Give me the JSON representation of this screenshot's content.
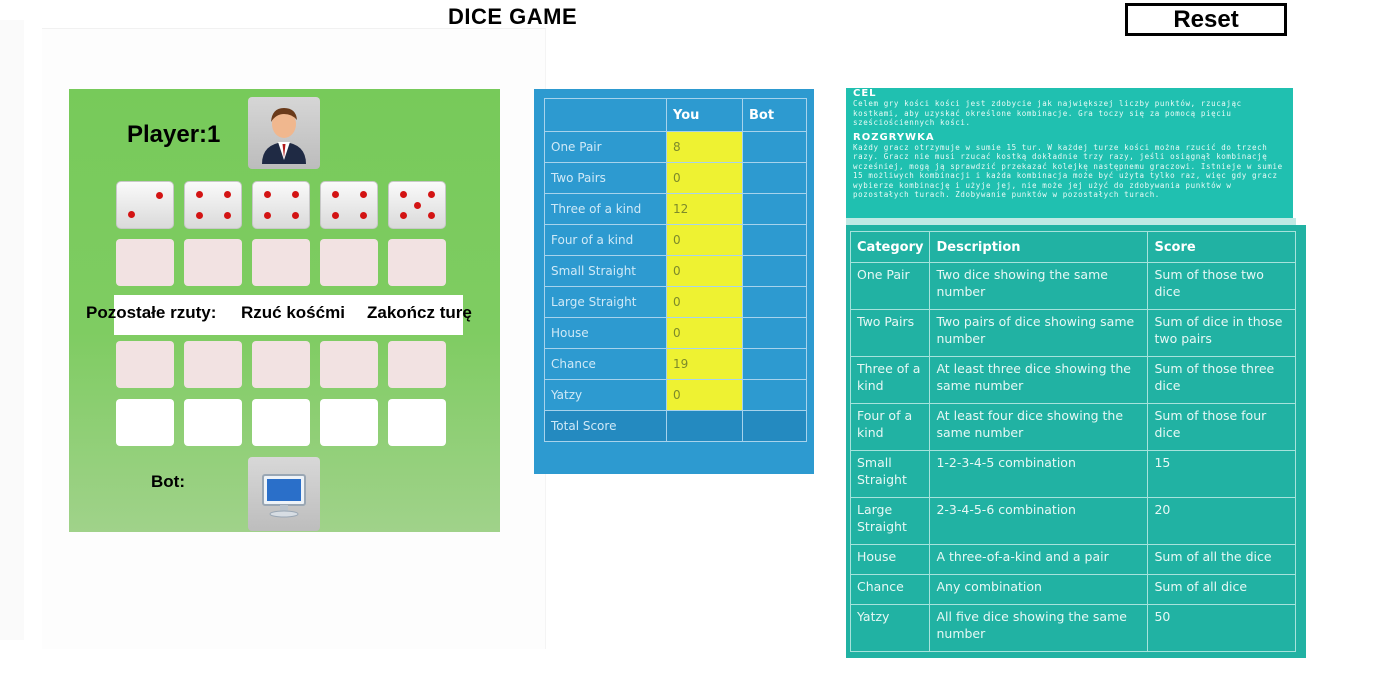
{
  "header": {
    "title": "DICE GAME",
    "reset_label": "Reset"
  },
  "board": {
    "player_label": "Player:1",
    "bot_label": "Bot:",
    "controls": {
      "remaining_label": "Pozostałe rzuty:",
      "roll_label": "Rzuć kośćmi",
      "end_turn_label": "Zakończ turę"
    },
    "dice_values": [
      2,
      4,
      4,
      4,
      5
    ],
    "colors": {
      "board": "#7fcc62",
      "pip": "#d31414"
    }
  },
  "score_table": {
    "headers": [
      "",
      "You",
      "Bot"
    ],
    "rows": [
      {
        "category": "One Pair",
        "you": "8",
        "bot": ""
      },
      {
        "category": "Two Pairs",
        "you": "0",
        "bot": ""
      },
      {
        "category": "Three of a kind",
        "you": "12",
        "bot": ""
      },
      {
        "category": "Four of a kind",
        "you": "0",
        "bot": ""
      },
      {
        "category": "Small Straight",
        "you": "0",
        "bot": ""
      },
      {
        "category": "Large Straight",
        "you": "0",
        "bot": ""
      },
      {
        "category": "House",
        "you": "0",
        "bot": ""
      },
      {
        "category": "Chance",
        "you": "19",
        "bot": ""
      },
      {
        "category": "Yatzy",
        "you": "0",
        "bot": ""
      }
    ],
    "total_label": "Total Score",
    "colors": {
      "background": "#2d9ad0",
      "highlight": "#eef232"
    }
  },
  "rules": {
    "goal_heading": "CEL",
    "goal_text": "Celem gry kości kości jest zdobycie jak największej liczby punktów, rzucając kostkami, aby uzyskać określone kombinacje. Gra toczy się za pomocą pięciu sześciościennych kości.",
    "play_heading": "ROZGRYWKA",
    "play_text": "Każdy gracz otrzymuje w sumie 15 tur. W każdej turze kości można rzucić do trzech razy. Gracz nie musi rzucać kostką dokładnie trzy razy, jeśli osiągnął kombinację wcześniej, mogą ją sprawdzić przekazać kolejkę następnemu graczowi. Istnieje w sumie 15 możliwych kombinacji i każda kombinacja może być użyta tylko raz, więc gdy gracz wybierze kombinację i użyje jej, nie może jej użyć do zdobywania punktów w pozostałych turach. Zdobywanie punktów w pozostałych turach."
  },
  "categories_table": {
    "headers": [
      "Category",
      "Description",
      "Score"
    ],
    "rows": [
      [
        "One Pair",
        "Two dice showing the same number",
        "Sum of those two dice"
      ],
      [
        "Two Pairs",
        "Two pairs of dice showing same number",
        "Sum of dice in those two pairs"
      ],
      [
        "Three of a kind",
        "At least three dice showing the same number",
        "Sum of those three dice"
      ],
      [
        "Four of a kind",
        "At least four dice showing the same number",
        "Sum of those four dice"
      ],
      [
        "Small Straight",
        "1-2-3-4-5 combination",
        "15"
      ],
      [
        "Large Straight",
        "2-3-4-5-6 combination",
        "20"
      ],
      [
        "House",
        "A three-of-a-kind and a pair",
        "Sum of all the dice"
      ],
      [
        "Chance",
        "Any combination",
        "Sum of all dice"
      ],
      [
        "Yatzy",
        "All five dice showing the same number",
        "50"
      ]
    ],
    "colors": {
      "background": "#21b2a3"
    }
  }
}
